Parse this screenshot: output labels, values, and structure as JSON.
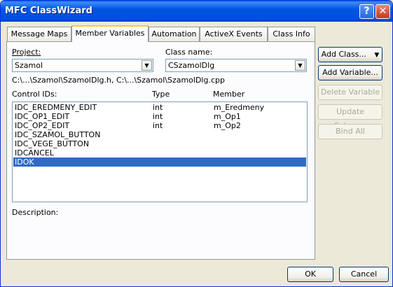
{
  "window": {
    "title": "MFC ClassWizard",
    "help_glyph": "?",
    "close_glyph": "✕"
  },
  "tabs": [
    {
      "label": "Message Maps",
      "active": false
    },
    {
      "label": "Member Variables",
      "active": true
    },
    {
      "label": "Automation",
      "active": false
    },
    {
      "label": "ActiveX Events",
      "active": false
    },
    {
      "label": "Class Info",
      "active": false
    }
  ],
  "project": {
    "label": "Project:",
    "value": "Szamol"
  },
  "class_name": {
    "label": "Class name:",
    "value": "CSzamolDlg"
  },
  "file_path": "C:\\...\\Szamol\\SzamolDlg.h, C:\\...\\Szamol\\SzamolDlg.cpp",
  "list": {
    "headers": {
      "control_ids": "Control IDs:",
      "type": "Type",
      "member": "Member"
    },
    "rows": [
      {
        "id": "IDC_EREDMENY_EDIT",
        "type": "int",
        "member": "m_Eredmeny"
      },
      {
        "id": "IDC_OP1_EDIT",
        "type": "int",
        "member": "m_Op1"
      },
      {
        "id": "IDC_OP2_EDIT",
        "type": "int",
        "member": "m_Op2"
      },
      {
        "id": "IDC_SZAMOL_BUTTON",
        "type": "",
        "member": ""
      },
      {
        "id": "IDC_VEGE_BUTTON",
        "type": "",
        "member": ""
      },
      {
        "id": "IDCANCEL",
        "type": "",
        "member": ""
      },
      {
        "id": "IDOK",
        "type": "",
        "member": "",
        "selected": true
      }
    ]
  },
  "description_label": "Description:",
  "buttons": {
    "add_class": "Add Class...",
    "add_class_arrow": "▼",
    "add_variable": "Add Variable...",
    "delete_variable": "Delete Variable",
    "update_columns": "Update Columns",
    "bind_all": "Bind All",
    "ok": "OK",
    "cancel": "Cancel"
  },
  "colors": {
    "title_bar": "#0054e3",
    "selection": "#316ac5",
    "dialog_bg": "#ece9d8"
  }
}
